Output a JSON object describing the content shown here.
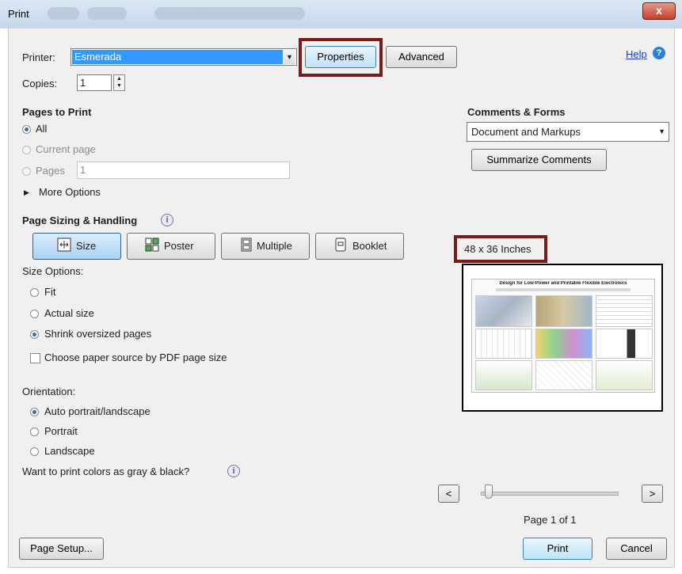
{
  "window": {
    "title": "Print",
    "close_label": "x"
  },
  "printer": {
    "label": "Printer:",
    "value": "Esmerada",
    "properties_label": "Properties",
    "advanced_label": "Advanced",
    "help_label": "Help"
  },
  "copies": {
    "label": "Copies:",
    "value": "1"
  },
  "pages_to_print": {
    "heading": "Pages to Print",
    "all_label": "All",
    "current_label": "Current page",
    "pages_label": "Pages",
    "pages_value": "1",
    "more_options_label": "More Options",
    "selected": "all"
  },
  "comments_forms": {
    "heading": "Comments & Forms",
    "value": "Document and Markups",
    "summarize_label": "Summarize Comments"
  },
  "sizing": {
    "heading": "Page Sizing & Handling",
    "tabs": [
      {
        "label": "Size",
        "selected": true,
        "icon": "size-icon"
      },
      {
        "label": "Poster",
        "selected": false,
        "icon": "poster-icon"
      },
      {
        "label": "Multiple",
        "selected": false,
        "icon": "multiple-icon"
      },
      {
        "label": "Booklet",
        "selected": false,
        "icon": "booklet-icon"
      }
    ],
    "size_options_label": "Size Options:",
    "fit_label": "Fit",
    "actual_label": "Actual size",
    "shrink_label": "Shrink oversized pages",
    "selected": "shrink",
    "paper_source_label": "Choose paper source by PDF page size",
    "paper_source_checked": false
  },
  "orientation": {
    "label": "Orientation:",
    "auto_label": "Auto portrait/landscape",
    "portrait_label": "Portrait",
    "landscape_label": "Landscape",
    "selected": "auto"
  },
  "grayscale": {
    "label": "Want to print colors as gray & black?"
  },
  "preview": {
    "size_label": "48 x 36 Inches",
    "poster_title": "Design for Low-Power and Printable Flexible Electronics",
    "page_label": "Page 1 of 1",
    "prev_label": "<",
    "next_label": ">",
    "slider_position": 0
  },
  "footer": {
    "page_setup_label": "Page Setup...",
    "print_label": "Print",
    "cancel_label": "Cancel"
  },
  "colors": {
    "highlight": "#7b1a1a",
    "accent": "#2a6ebd",
    "link": "#1a3fc4"
  }
}
